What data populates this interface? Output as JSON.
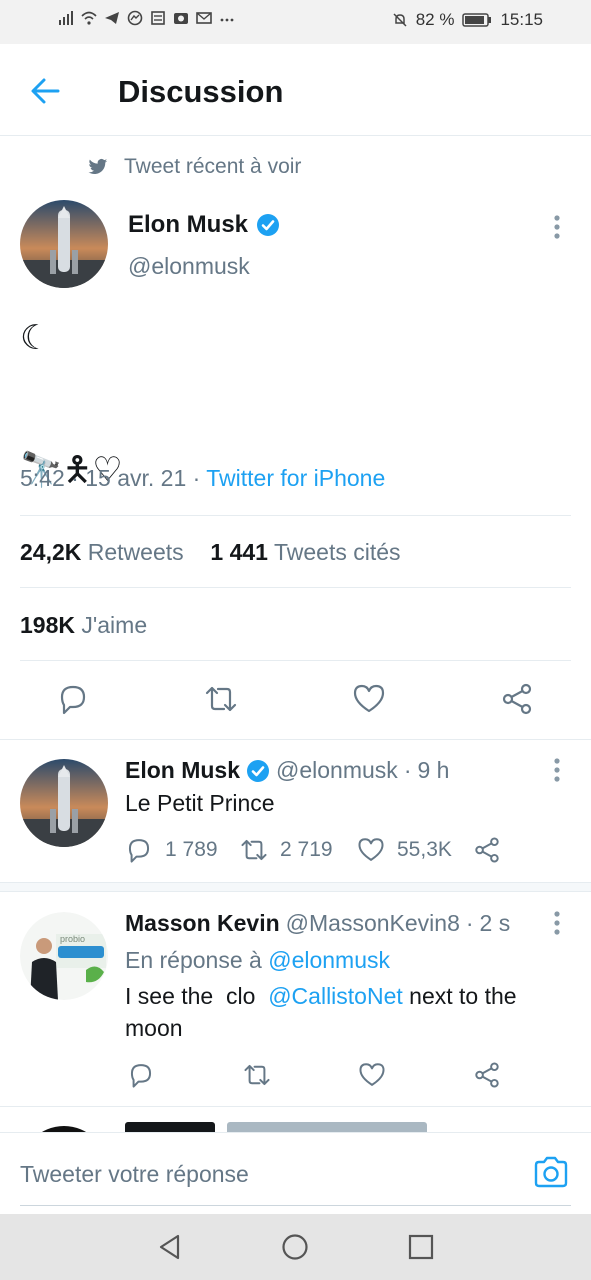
{
  "status_bar": {
    "left_icons": [
      "signal-icon",
      "wifi-icon",
      "telegram-icon",
      "messenger-icon",
      "notes-icon",
      "photo-icon",
      "mail-icon",
      "more-icon"
    ],
    "battery": "82 %",
    "time": "15:15"
  },
  "header": {
    "title": "Discussion"
  },
  "context": {
    "label": "Tweet récent à voir"
  },
  "main_tweet": {
    "author_name": "Elon Musk",
    "handle": "@elonmusk",
    "text": "☾\n\n\n🔭🯅♡",
    "time": "5:42",
    "date": "15 avr. 21",
    "source": "Twitter for iPhone",
    "retweets_count": "24,2K",
    "retweets_label": "Retweets",
    "quotes_count": "1 441",
    "quotes_label": "Tweets cités",
    "likes_count": "198K",
    "likes_label": "J'aime"
  },
  "replies": [
    {
      "name": "Elon Musk",
      "handle": "@elonmusk",
      "time": "9 h",
      "text": "Le Petit Prince",
      "replies": "1 789",
      "retweets": "2 719",
      "likes": "55,3K"
    },
    {
      "name": "Masson Kevin",
      "handle": "@MassonKevin8",
      "time": "2 s",
      "in_reply_label": "En réponse à",
      "in_reply_handle": "@elonmusk",
      "text_before": "I see the  clo  ",
      "text_link": "@CallistoNet",
      "text_after": " next to the moon"
    }
  ],
  "compose": {
    "placeholder": "Tweeter votre réponse"
  },
  "colors": {
    "accent": "#1da1f2",
    "secondary_text": "#657786",
    "primary_text": "#14171a"
  }
}
